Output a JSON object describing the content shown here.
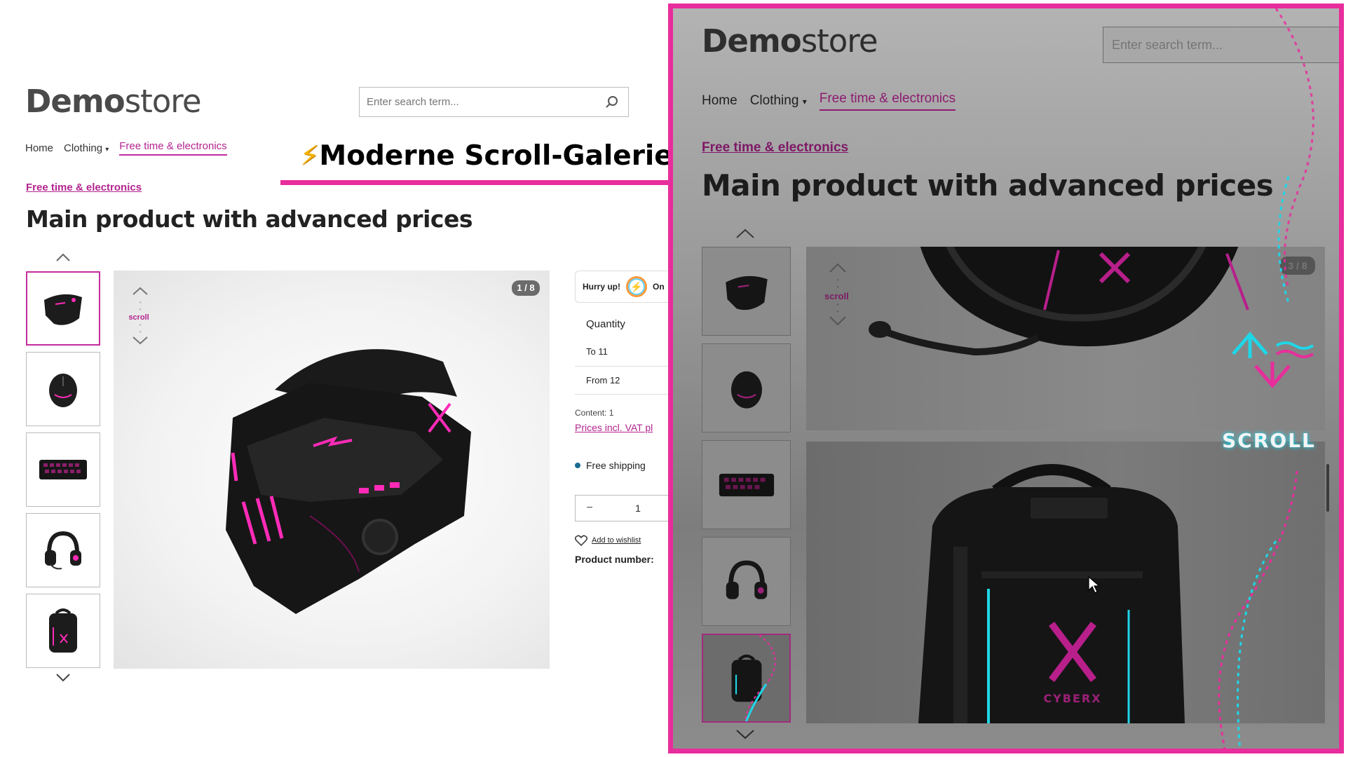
{
  "brand": {
    "bold": "Demo",
    "light": "store"
  },
  "search": {
    "placeholder": "Enter search term..."
  },
  "nav": [
    {
      "label": "Home"
    },
    {
      "label": "Clothing"
    },
    {
      "label": "Free time & electronics"
    }
  ],
  "breadcrumb": "Free time & electronics",
  "product": {
    "title": "Main product with advanced prices",
    "counter_left": "1 / 8",
    "counter_right": "3 / 8",
    "scroll_small": "scroll"
  },
  "thumbnails": [
    "gaming-mask",
    "gaming-mouse",
    "keyboard",
    "headset",
    "backpack"
  ],
  "buybox": {
    "hurry": "Hurry up!",
    "hurry_tail": "On",
    "quantity_header": "Quantity",
    "tier1": "To 11",
    "tier2": "From 12",
    "content": "Content: 1",
    "vat_link": "Prices incl. VAT pl",
    "shipping": "Free shipping",
    "qty_value": "1",
    "minus": "−",
    "wishlist": "Add to wishlist",
    "product_number": "Product number:"
  },
  "callout": {
    "text": "Moderne Scroll-Galerie"
  },
  "scroll_overlay": {
    "label": "SCROLL"
  },
  "backpack_brand": "CYBERX",
  "colors": {
    "accent": "#c42c9e",
    "frame": "#e82d9c",
    "cyan": "#1fd6e6",
    "shipping_dot": "#1b6c8f"
  },
  "icons": [
    "search-icon",
    "chevron-up-icon",
    "chevron-down-icon",
    "caret-down-icon",
    "heart-icon",
    "lightning-icon",
    "mouse-cursor-icon",
    "arrow-up-icon",
    "arrow-down-icon",
    "wave-icon"
  ]
}
